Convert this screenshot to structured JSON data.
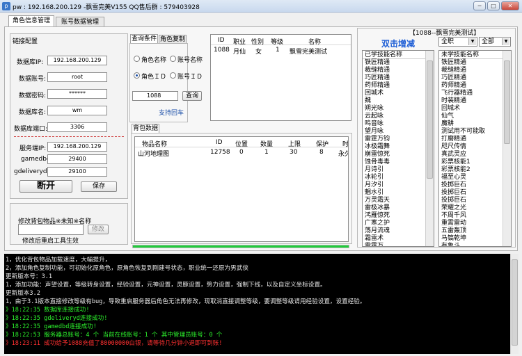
{
  "window": {
    "title": "pw : 192.168.200.129     -飘雪完美V155 QQ售后群 : 579403928",
    "min_label": "─",
    "max_label": "□",
    "close_label": "✕"
  },
  "tabs": [
    {
      "label": "角色信息管理"
    },
    {
      "label": "账号数据管理"
    }
  ],
  "link_config": {
    "title": "链接配置",
    "db_ip_label": "数据库IP:",
    "db_ip": "192.168.200.129",
    "db_user_label": "数据账号:",
    "db_user": "root",
    "db_pass_label": "数据密码:",
    "db_pass": "******",
    "db_name_label": "数据库名:",
    "db_name": "wm",
    "db_port_label": "数据库端口:",
    "db_port": "3306",
    "srv_ip_label": "服务端IP:",
    "srv_ip": "192.168.200.129",
    "gamedbd_label": "gamedbd:",
    "gamedbd": "29400",
    "gdeliveryd_label": "gdeliveryd:",
    "gdeliveryd": "29100",
    "disconnect_label": "断开",
    "save_label": "保存"
  },
  "modify_item": {
    "title": "修改背包物品※未知※名称",
    "input_value": "",
    "button_label": "修改",
    "note": "修改后重启工具生效"
  },
  "query": {
    "tabs": [
      {
        "label": "查询条件"
      },
      {
        "label": "角色复制"
      }
    ],
    "radio_role_name": "角色名称",
    "radio_account_name": "账号名称",
    "radio_role_id": "角色ＩＤ",
    "radio_account_id": "账号ＩＤ",
    "input_value": "1088",
    "query_button": "查询",
    "enter_note": "支持回车"
  },
  "role_table": {
    "headers": [
      "ID",
      "职业",
      "性别",
      "等级",
      "名称"
    ],
    "rows": [
      {
        "id": "1088",
        "job": "月仙",
        "gender": "女",
        "level": "1",
        "name": "飘雪完美测试"
      }
    ]
  },
  "bag": {
    "tab_label": "背包数据",
    "headers": [
      "物品名称",
      "ID",
      "位置",
      "数量",
      "上限",
      "保护",
      "时"
    ],
    "rows": [
      {
        "name": "山河地理图",
        "id": "12758",
        "pos": "0",
        "count": "1",
        "limit": "30",
        "protect": "8",
        "time": "永久"
      }
    ],
    "progress": 1.0
  },
  "skills": {
    "header_title": "【1088--飘雪完美测试】",
    "double_click_label": "双击增减",
    "job_select": "全职",
    "type_select": "全部",
    "learned_header": "已学技能名称",
    "learned": [
      "铁匠精通",
      "裁缝精通",
      "巧匠精通",
      "药师精通",
      "回城术",
      "魏",
      "朔光咏",
      "云起咏",
      "鸣音咏",
      "望月咏",
      "雷霆万钧",
      "冰极霜舞",
      "崩雷惊死",
      "蚀骨毒毒",
      "月诗引",
      "冰轮引",
      "月汐引",
      "魍水引",
      "万灵霜天",
      "雷极冰暴",
      "鸿雁惊死",
      "广寒之护",
      "荡月流魂",
      "霜雷术",
      "雷霆万"
    ],
    "unlearned_header": "未学技能名称",
    "unlearned": [
      "铁匠精通",
      "裁缝精通",
      "巧匠精通",
      "药师精通",
      "飞行器精通",
      "时装精通",
      "回城术",
      "仙气",
      "魔耕",
      "测试用不可能取",
      "打磨精通",
      "咫尺传情",
      "真武灵应",
      "彩票核能1",
      "彩票核能2",
      "福至心灵",
      "投掷巨石",
      "投掷巨石",
      "投掷巨石",
      "荣耀之光",
      "不周千风",
      "重霄雷动",
      "五雷轰顶",
      "马镐乾坤",
      "有象斗"
    ]
  },
  "console": {
    "lines": [
      {
        "text": "1，优化背包物品加载速度，大幅提升，",
        "color": "white"
      },
      {
        "text": "2，添加角色复制功能，可初始化原角色，原角色恢复到刚建号状态，职业统一还原为男武侠",
        "color": "white"
      },
      {
        "text": "更新版本号：3.1",
        "color": "white"
      },
      {
        "text": "1，添加功能：声望设置，等级转身设置，经验设置，元神设置，灵豚设置，势力设置，强制下线，以及自定义坐标设置。",
        "color": "white"
      },
      {
        "text": "更新版本3.2",
        "color": "white"
      },
      {
        "text": "1，由于3.1版本直接修改等级有bug，导致重启服务器后角色无法再修改，现取消直接调整等级，要调整等级请用经验设置，设置经验。",
        "color": "white"
      },
      {
        "text": "》18:22:35 数据库连接成功!",
        "color": "green"
      },
      {
        "text": "》18:22:35 gdeliveryd连接成功!",
        "color": "green"
      },
      {
        "text": "》18:22:35 gamedbd连接成功!",
        "color": "green"
      },
      {
        "text": "》18:22:53 服务器总账号：4 个     当前在线账号：1 个     其中管理员账号：0 个",
        "color": "green"
      },
      {
        "text": "》18:23:11 成功给予1088充值了80000000白银，请等待几分钟小退即可到账!",
        "color": "red"
      }
    ]
  }
}
